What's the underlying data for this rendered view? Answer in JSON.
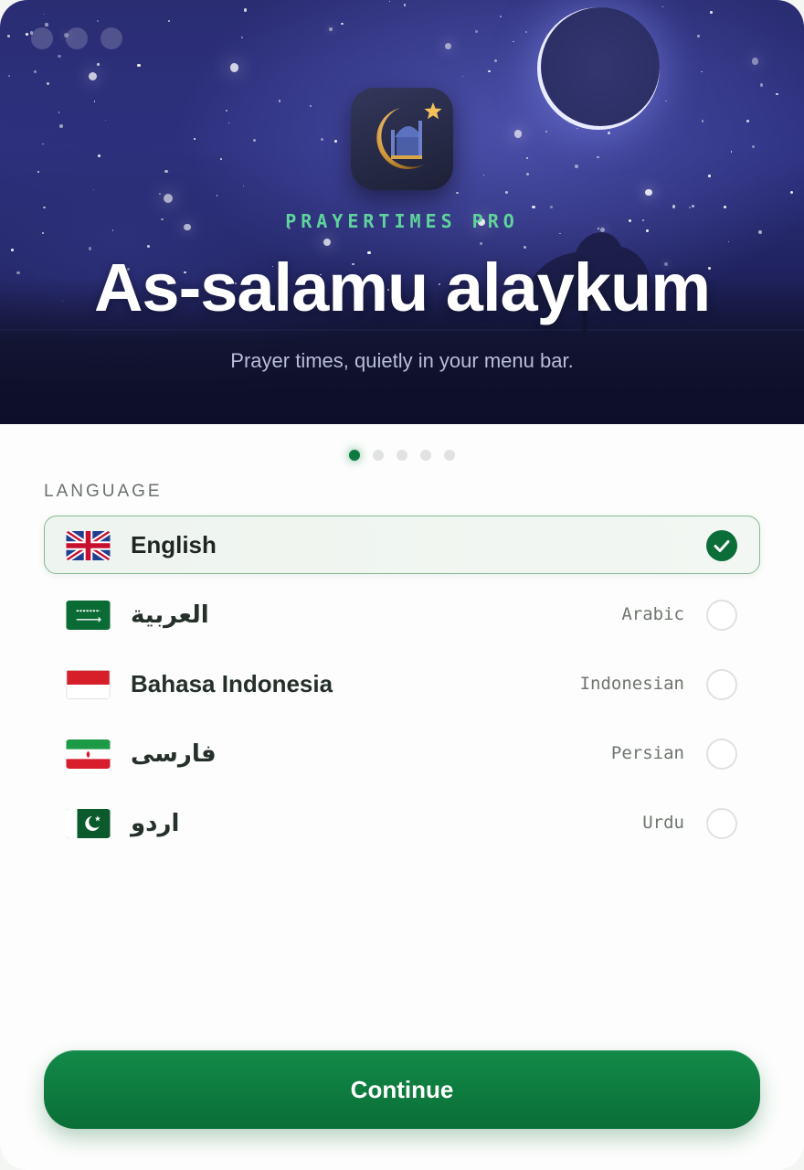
{
  "app": {
    "brand": "PRAYERTIMES PRO",
    "greeting": "As-salamu alaykum",
    "tagline": "Prayer times, quietly in your menu bar.",
    "icon": "crescent-mosque-icon"
  },
  "onboarding": {
    "total_steps": 5,
    "current_step": 1
  },
  "language_section": {
    "label": "LANGUAGE",
    "options": [
      {
        "native": "English",
        "english": "",
        "flag": "uk-flag-icon",
        "selected": true
      },
      {
        "native": "العربية",
        "english": "Arabic",
        "flag": "saudi-flag-icon",
        "selected": false
      },
      {
        "native": "Bahasa Indonesia",
        "english": "Indonesian",
        "flag": "indonesia-flag-icon",
        "selected": false
      },
      {
        "native": "فارسی",
        "english": "Persian",
        "flag": "iran-flag-icon",
        "selected": false
      },
      {
        "native": "اردو",
        "english": "Urdu",
        "flag": "pakistan-flag-icon",
        "selected": false
      }
    ]
  },
  "actions": {
    "continue_label": "Continue"
  },
  "colors": {
    "accent": "#0b6e38",
    "brand_text": "#5ed49b",
    "hero_background": "#2a2d72"
  }
}
